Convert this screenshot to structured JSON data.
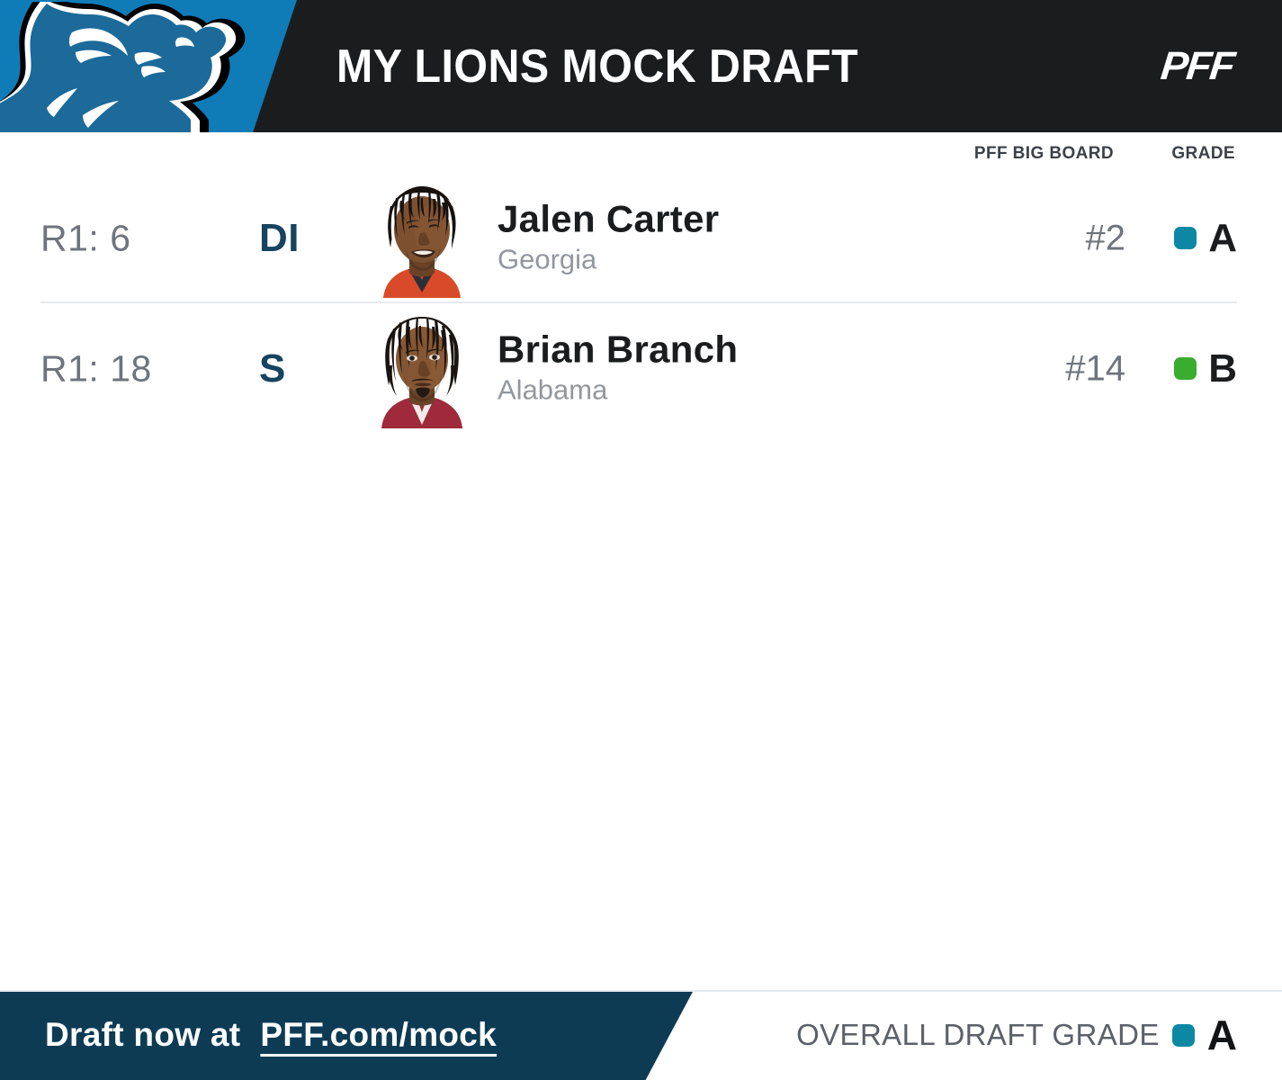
{
  "header": {
    "title": "MY LIONS MOCK DRAFT",
    "brand_logo": "PFF",
    "team_logo_icon": "detroit-lions-logo",
    "team_panel_color": "#0f7cb8",
    "background_color": "#1a1c1e"
  },
  "columns": {
    "pick": "",
    "position": "",
    "player": "",
    "big_board": "PFF BIG BOARD",
    "grade": "GRADE"
  },
  "picks": [
    {
      "pick": "R1: 6",
      "position": "DI",
      "name": "Jalen Carter",
      "school": "Georgia",
      "big_board": "#2",
      "grade": "A",
      "grade_color": "#0c88a4",
      "headshot_icon": "player-headshot-jalen-carter",
      "jersey_color": "#d94a2b"
    },
    {
      "pick": "R1: 18",
      "position": "S",
      "name": "Brian Branch",
      "school": "Alabama",
      "big_board": "#14",
      "grade": "B",
      "grade_color": "#3aac2e",
      "headshot_icon": "player-headshot-brian-branch",
      "jersey_color": "#9e2a3c"
    }
  ],
  "footer": {
    "cta_label": "Draft now at",
    "cta_link": "PFF.com/mock",
    "panel_color": "#0d3b54",
    "overall_label": "OVERALL DRAFT GRADE",
    "overall_grade": "A",
    "overall_grade_color": "#0c88a4"
  }
}
